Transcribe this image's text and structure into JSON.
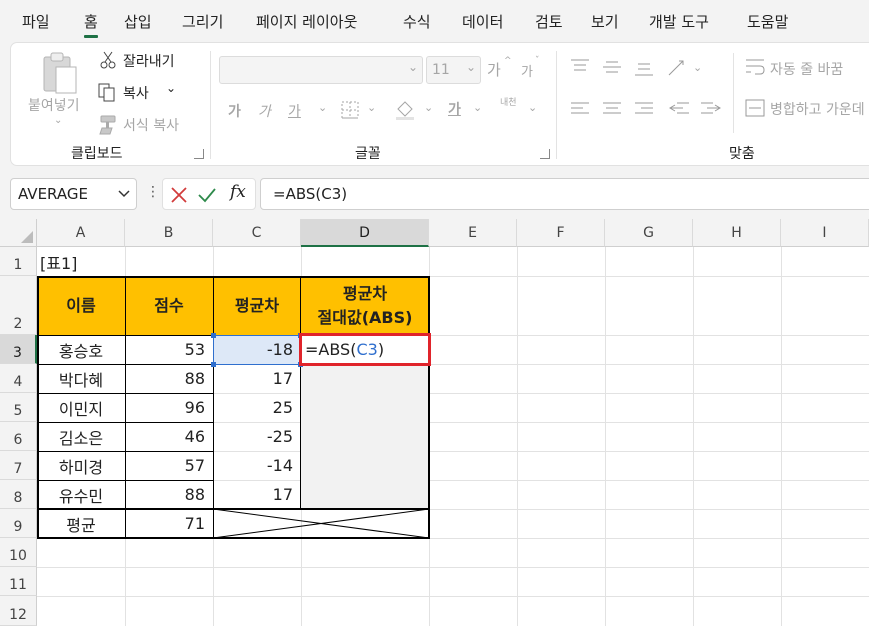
{
  "menu": {
    "tabs": [
      "파일",
      "홈",
      "삽입",
      "그리기",
      "페이지 레이아웃",
      "수식",
      "데이터",
      "검토",
      "보기",
      "개발 도구",
      "도움말"
    ],
    "active_tab": "홈"
  },
  "ribbon": {
    "clipboard": {
      "paste_label": "붙여넣기",
      "cut_label": "잘라내기",
      "copy_label": "복사",
      "format_painter_label": "서식 복사",
      "group_label": "클립보드"
    },
    "font": {
      "font_name": "",
      "font_size": "11",
      "grow_label": "가",
      "shrink_label": "가",
      "bold_label": "가",
      "italic_label": "가",
      "underline_label": "가",
      "color_label": "가",
      "phonetic_label": "내천",
      "group_label": "글꼴"
    },
    "alignment": {
      "wrap_label": "자동 줄 바꿈",
      "merge_label": "병합하고 가운데",
      "group_label": "맞춤"
    }
  },
  "formula_bar": {
    "name_box": "AVERAGE",
    "fx_label": "fx",
    "formula": "=ABS(C3)"
  },
  "sheet": {
    "columns": [
      "A",
      "B",
      "C",
      "D",
      "E",
      "F",
      "G",
      "H",
      "I"
    ],
    "rows": [
      "1",
      "2",
      "3",
      "4",
      "5",
      "6",
      "7",
      "8",
      "9",
      "10",
      "11",
      "12"
    ],
    "title": "[표1]",
    "headers": {
      "name": "이름",
      "score": "점수",
      "avg_diff": "평균차",
      "abs_diff_line1": "평균차",
      "abs_diff_line2": "절대값(ABS)"
    },
    "records": [
      {
        "name": "홍승호",
        "score": "53",
        "diff": "-18"
      },
      {
        "name": "박다혜",
        "score": "88",
        "diff": "17"
      },
      {
        "name": "이민지",
        "score": "96",
        "diff": "25"
      },
      {
        "name": "김소은",
        "score": "46",
        "diff": "-25"
      },
      {
        "name": "하미경",
        "score": "57",
        "diff": "-14"
      },
      {
        "name": "유수민",
        "score": "88",
        "diff": "17"
      }
    ],
    "average_label": "평균",
    "average_value": "71",
    "editing": {
      "prefix": "=ABS(",
      "ref": "C3",
      "suffix": ")"
    }
  },
  "colors": {
    "header_fill": "#ffc000",
    "selection_green": "#1e7145",
    "edit_box_red": "#e0242b",
    "ref_blue": "#2f6fce"
  }
}
